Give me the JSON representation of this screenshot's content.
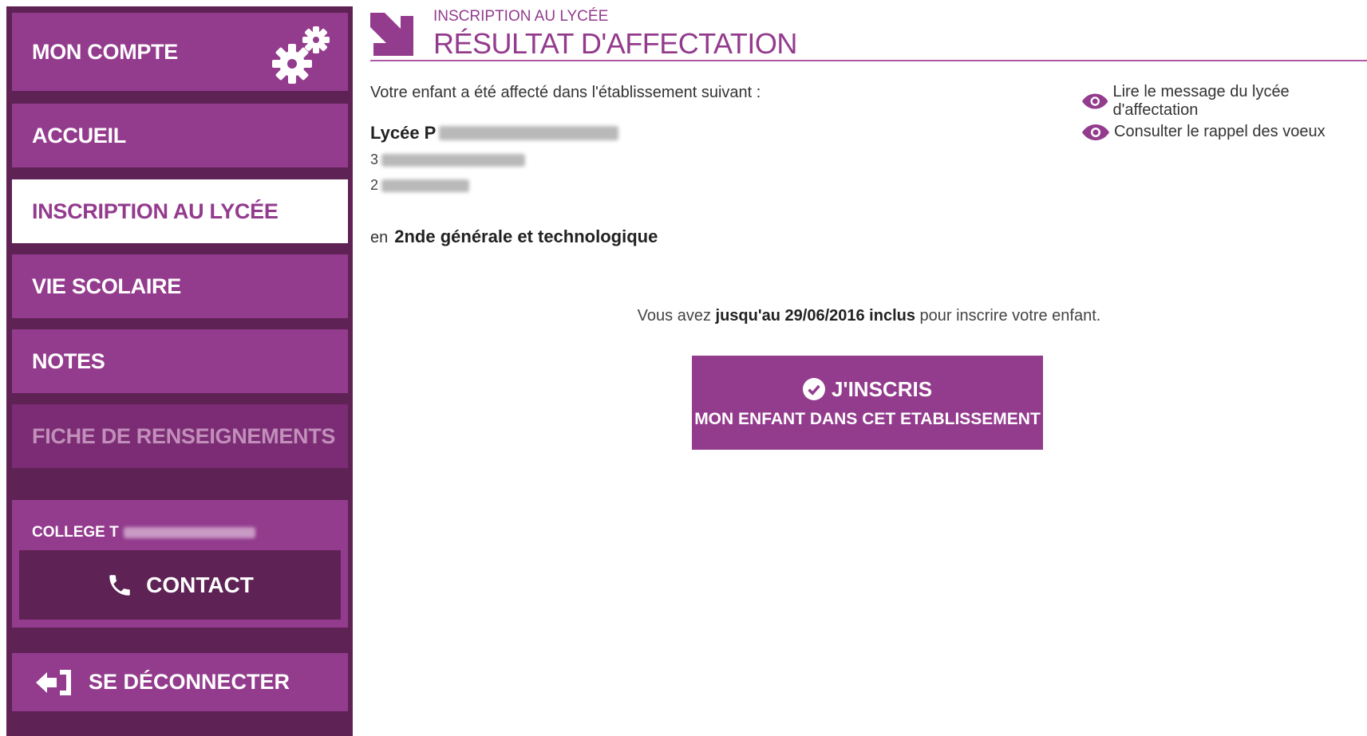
{
  "sidebar": {
    "account": "MON COMPTE",
    "items": [
      {
        "label": "ACCUEIL"
      },
      {
        "label": "INSCRIPTION AU LYCÉE"
      },
      {
        "label": "VIE SCOLAIRE"
      },
      {
        "label": "NOTES"
      },
      {
        "label": "FICHE DE RENSEIGNEMENTS"
      }
    ],
    "college_label": "COLLEGE T",
    "contact_label": "CONTACT",
    "logout_label": "SE DÉCONNECTER"
  },
  "header": {
    "kicker": "INSCRIPTION AU LYCÉE",
    "title": "RÉSULTAT D'AFFECTATION"
  },
  "main": {
    "intro": "Votre enfant a été affecté dans l'établissement suivant :",
    "school_name": "Lycée P",
    "address_line1": "3",
    "address_line2": "2",
    "level_prefix": "en",
    "level": "2nde générale et technologique",
    "deadline_prefix": "Vous avez",
    "deadline_bold": "jusqu'au 29/06/2016 inclus",
    "deadline_suffix": "pour inscrire votre enfant.",
    "button_line1": "J'INSCRIS",
    "button_line2": "MON ENFANT DANS CET ETABLISSEMENT",
    "link_message": "Lire le message du lycée d'affectation",
    "link_rappel": "Consulter le rappel des voeux"
  },
  "colors": {
    "accent": "#933b8d",
    "sidebar_dark": "#5e2254",
    "header_text": "#933b8d"
  }
}
